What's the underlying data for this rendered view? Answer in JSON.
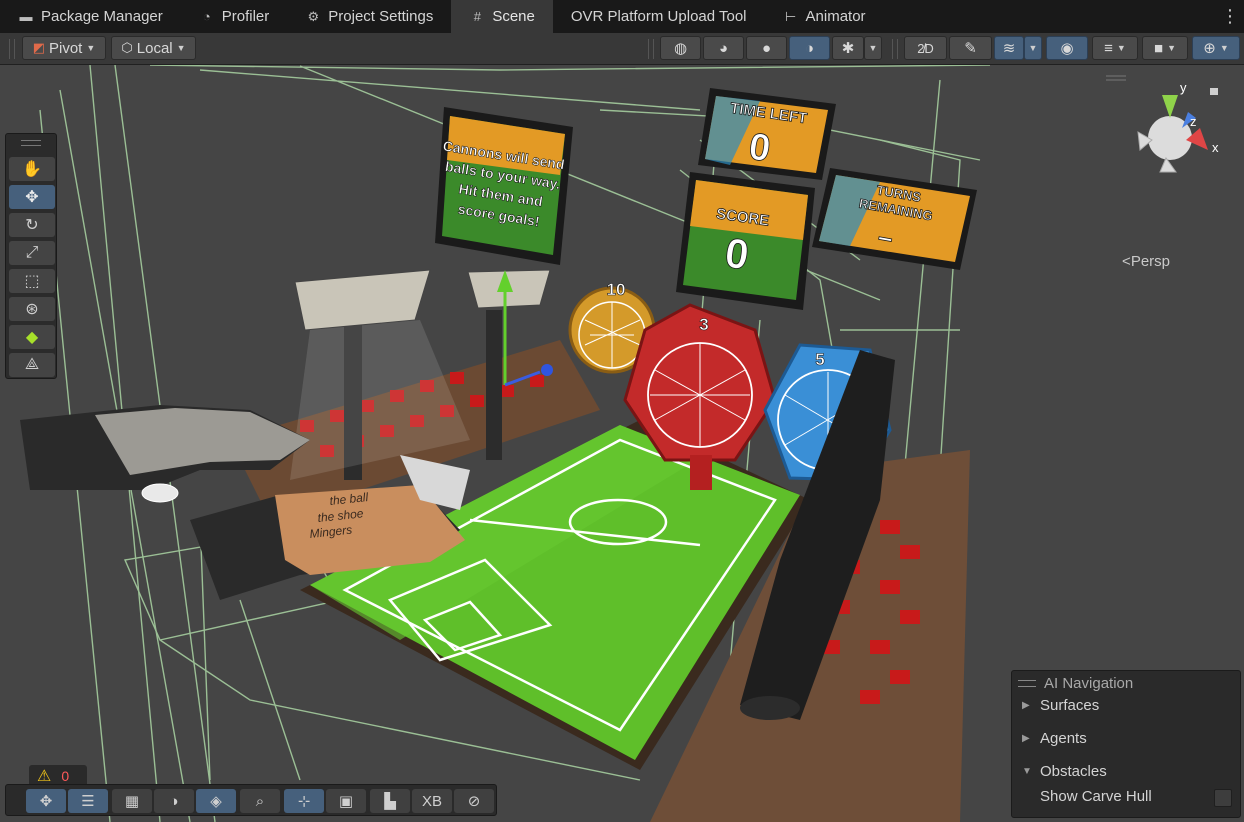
{
  "tabs": [
    {
      "label": "Package Manager",
      "icon": "package-icon",
      "glyph": "▬"
    },
    {
      "label": "Profiler",
      "icon": "profiler-icon",
      "glyph": "◔"
    },
    {
      "label": "Project Settings",
      "icon": "gear-icon",
      "glyph": "⚙"
    },
    {
      "label": "Scene",
      "icon": "grid-icon",
      "glyph": "#",
      "active": true
    },
    {
      "label": "OVR Platform Upload Tool",
      "icon": "",
      "glyph": ""
    },
    {
      "label": "Animator",
      "icon": "animator-icon",
      "glyph": "⊢"
    }
  ],
  "toolbar": {
    "pivot_label": "Pivot",
    "local_label": "Local",
    "render_modes": [
      "wireframe",
      "shaded-wireframe",
      "shaded",
      "unlit-lighting"
    ],
    "accent": "#46607c"
  },
  "tools": [
    "hand",
    "move",
    "rotate",
    "scale",
    "rect",
    "transform",
    "custom",
    "bone"
  ],
  "gizmo": {
    "y": "y",
    "z": "z",
    "x": "x",
    "projection": "Persp"
  },
  "scene_text": {
    "sign_main": [
      "Cannons will send",
      "balls to your way.",
      "Hit them and",
      "score goals!"
    ],
    "time_left_title": "TIME LEFT",
    "time_left_value": "0",
    "score_title": "SCORE",
    "score_value": "0",
    "turns_title": [
      "TURNS",
      "REMAINING"
    ],
    "turns_value": "–",
    "target_10": "10",
    "target_3": "3",
    "target_5": "5",
    "glove_text": [
      "the ball",
      "the shoe",
      "Mingers"
    ]
  },
  "ai_navigation": {
    "title": "AI Navigation",
    "sections": [
      {
        "label": "Surfaces",
        "expanded": false
      },
      {
        "label": "Agents",
        "expanded": false
      },
      {
        "label": "Obstacles",
        "expanded": true
      }
    ],
    "option_label": "Show Carve Hull"
  },
  "warnings": {
    "count": "0"
  },
  "bottom_tools": [
    "move",
    "sliders",
    "hatch",
    "moon",
    "layers",
    "search",
    "pivot",
    "camera",
    "buildings",
    "XB",
    "compass"
  ],
  "bottom_xb": "XB"
}
